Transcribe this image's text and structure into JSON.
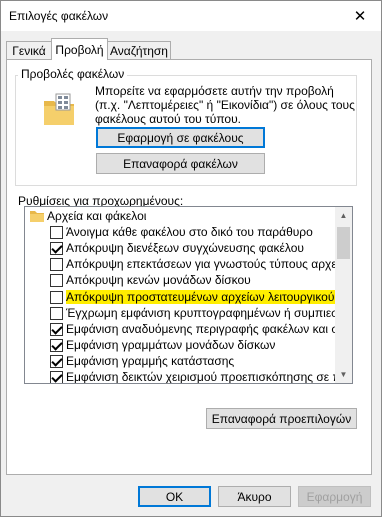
{
  "window": {
    "title": "Επιλογές φακέλων",
    "close_symbol": "✕"
  },
  "tabs": [
    {
      "label": "Γενικά",
      "selected": false
    },
    {
      "label": "Προβολή",
      "selected": true
    },
    {
      "label": "Αναζήτηση",
      "selected": false
    }
  ],
  "folder_views": {
    "legend": "Προβολές φακέλων",
    "description": "Μπορείτε να εφαρμόσετε αυτήν την προβολή (π.χ. \"Λεπτομέρειες\" ή \"Εικονίδια\") σε όλους τους φακέλους αυτού του τύπου.",
    "apply_button": "Εφαρμογή σε φακέλους",
    "reset_button": "Επαναφορά φακέλων"
  },
  "advanced": {
    "label": "Ρυθμίσεις για προχωρημένους:",
    "folder_node": "Αρχεία και φάκελοι",
    "items": [
      {
        "label": "Άνοιγμα κάθε φακέλου στο δικό του παράθυρο",
        "checked": false,
        "highlight": false
      },
      {
        "label": "Απόκρυψη διενέξεων συγχώνευσης φακέλου",
        "checked": true,
        "highlight": false
      },
      {
        "label": "Απόκρυψη επεκτάσεων για γνωστούς τύπους αρχείων",
        "checked": false,
        "highlight": false
      },
      {
        "label": "Απόκρυψη κενών μονάδων δίσκου",
        "checked": false,
        "highlight": false
      },
      {
        "label": "Απόκρυψη προστατευμένων αρχείων λειτουργικού συ",
        "checked": false,
        "highlight": true
      },
      {
        "label": "Έγχρωμη εμφάνιση κρυπτογραφημένων ή συμπιεσμέ",
        "checked": false,
        "highlight": false
      },
      {
        "label": "Εμφάνιση αναδυόμενης περιγραφής φακέλων και στο",
        "checked": true,
        "highlight": false
      },
      {
        "label": "Εμφάνιση γραμμάτων μονάδων δίσκων",
        "checked": true,
        "highlight": false
      },
      {
        "label": "Εμφάνιση γραμμής κατάστασης",
        "checked": true,
        "highlight": false
      },
      {
        "label": "Εμφάνιση δεικτών χειρισμού προεπισκόπησης σε παρά",
        "checked": true,
        "highlight": false
      }
    ],
    "restore_defaults_button": "Επαναφορά προεπιλογών"
  },
  "dialog_buttons": {
    "ok": "OK",
    "cancel": "Άκυρο",
    "apply": "Εφαρμογή"
  },
  "colors": {
    "highlight": "#ffee00",
    "focus_border": "#0078d7",
    "disabled_text": "#a0a0a0"
  }
}
